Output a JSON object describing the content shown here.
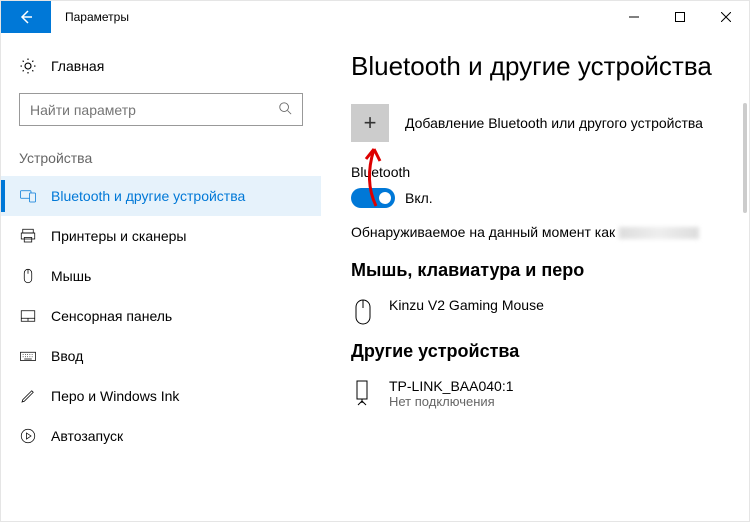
{
  "window": {
    "title": "Параметры"
  },
  "sidebar": {
    "home": "Главная",
    "searchPlaceholder": "Найти параметр",
    "category": "Устройства",
    "items": [
      {
        "label": "Bluetooth и другие устройства"
      },
      {
        "label": "Принтеры и сканеры"
      },
      {
        "label": "Мышь"
      },
      {
        "label": "Сенсорная панель"
      },
      {
        "label": "Ввод"
      },
      {
        "label": "Перо и Windows Ink"
      },
      {
        "label": "Автозапуск"
      }
    ]
  },
  "main": {
    "heading": "Bluetooth и другие устройства",
    "addLabel": "Добавление Bluetooth или другого устройства",
    "bluetooth": {
      "label": "Bluetooth",
      "stateLabel": "Вкл.",
      "on": true
    },
    "discover": "Обнаруживаемое на данный момент как",
    "mkpHeading": "Мышь, клавиатура и перо",
    "mkpDevice": "Kinzu V2 Gaming Mouse",
    "otherHeading": "Другие устройства",
    "otherDevice": {
      "name": "TP-LINK_BAA040:1",
      "status": "Нет подключения"
    }
  }
}
